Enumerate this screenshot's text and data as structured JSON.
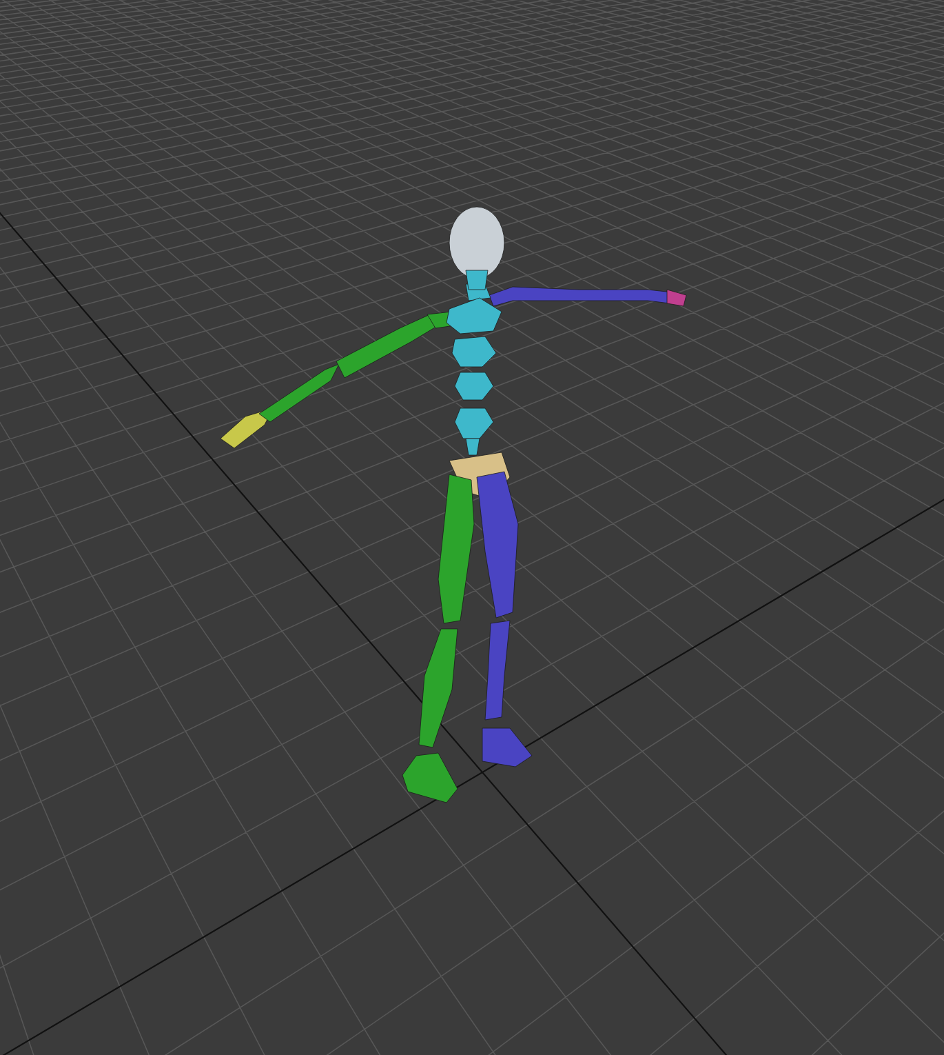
{
  "viewport": {
    "grid": {
      "visible": true
    },
    "figure": {
      "kind": "biped"
    }
  }
}
